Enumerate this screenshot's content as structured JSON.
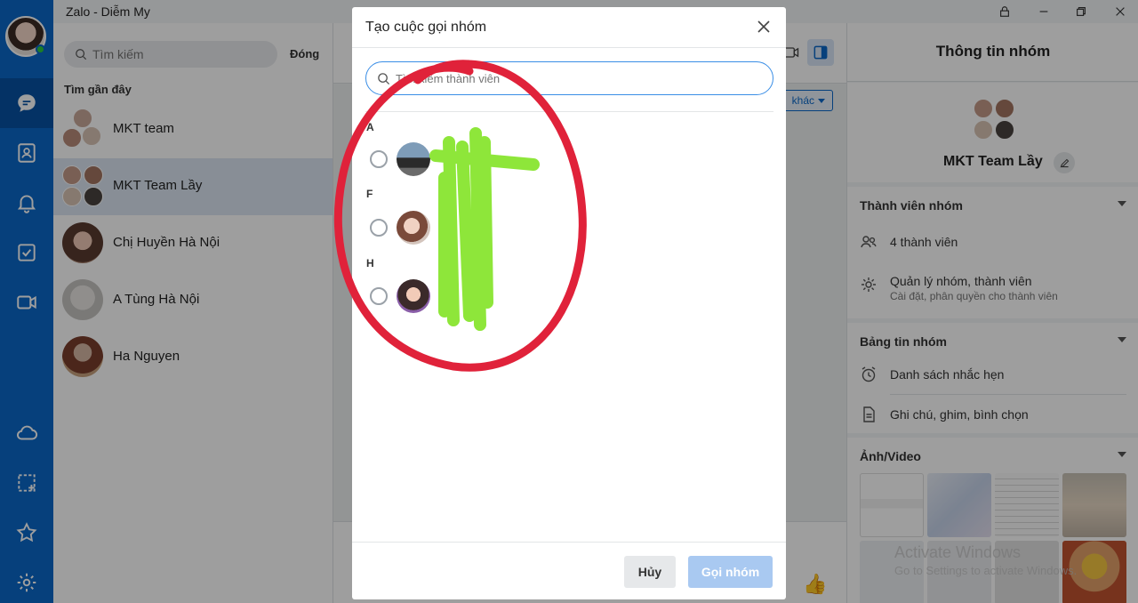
{
  "window": {
    "title": "Zalo - Diễm My"
  },
  "sidebar": {
    "search_placeholder": "Tìm kiếm",
    "close_label": "Đóng",
    "recent_title": "Tìm gần đây",
    "conversations": [
      {
        "name": "MKT team"
      },
      {
        "name": "MKT Team Lầy"
      },
      {
        "name": "Chị Huyền Hà Nội"
      },
      {
        "name": "A Tùng Hà Nội"
      },
      {
        "name": "Ha Nguyen"
      }
    ]
  },
  "chat": {
    "more_label": "khác"
  },
  "info_panel": {
    "title": "Thông tin nhóm",
    "group_name": "MKT Team Lầy",
    "members_section": "Thành viên nhóm",
    "member_count": "4 thành viên",
    "manage_title": "Quản lý nhóm, thành viên",
    "manage_sub": "Cài đặt, phân quyền cho thành viên",
    "board_section": "Bảng tin nhóm",
    "reminders": "Danh sách nhắc hẹn",
    "notes": "Ghi chú, ghim, bình chọn",
    "media_section": "Ảnh/Video"
  },
  "watermark": {
    "line1": "Activate Windows",
    "line2": "Go to Settings to activate Windows."
  },
  "modal": {
    "title": "Tạo cuộc gọi nhóm",
    "search_placeholder": "Tìm kiếm thành viên",
    "groups": [
      {
        "letter": "A",
        "member": ""
      },
      {
        "letter": "F",
        "member": ""
      },
      {
        "letter": "H",
        "member": ""
      }
    ],
    "cancel_label": "Hủy",
    "call_label": "Gọi nhóm"
  },
  "colors": {
    "brand": "#0a68c9",
    "selected_row": "#dbe6f3",
    "call_disabled": "#a9c9f1",
    "annotation_circle": "#e0223a",
    "annotation_scribble": "#8ee63a"
  }
}
